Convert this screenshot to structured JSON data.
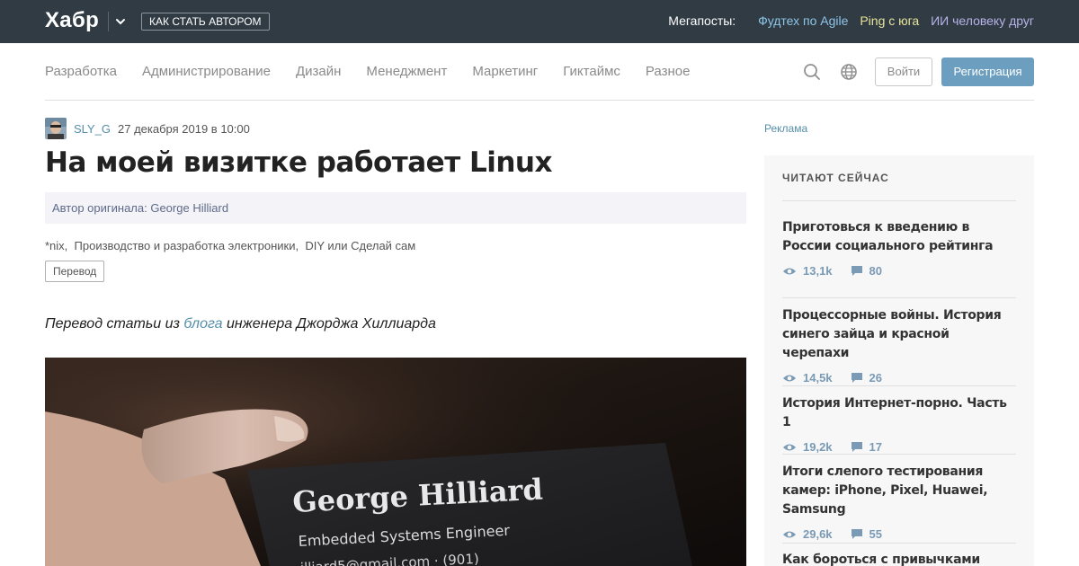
{
  "topbar": {
    "logo": "Хабр",
    "become_author": "КАК СТАТЬ АВТОРОМ",
    "megaposts_label": "Мегапосты:",
    "megaposts": [
      {
        "label": "Фудтех по Agile",
        "color": "#8ec5e8"
      },
      {
        "label": "Ping с юга",
        "color": "#e8e49a"
      },
      {
        "label": "ИИ человеку друг",
        "color": "#b8b3e8"
      }
    ]
  },
  "nav": {
    "items": [
      "Разработка",
      "Администрирование",
      "Дизайн",
      "Менеджмент",
      "Маркетинг",
      "Гиктаймс",
      "Разное"
    ],
    "login": "Войти",
    "register": "Регистрация"
  },
  "article": {
    "author": "SLY_G",
    "date": "27 декабря 2019 в 10:00",
    "title": "На моей визитке работает Linux",
    "original_author": "Автор оригинала: George Hilliard",
    "hubs": [
      "*nix,",
      "Производство и разработка электроники,",
      "DIY или Сделай сам"
    ],
    "badge": "Перевод",
    "lead_before": "Перевод статьи из ",
    "lead_link": "блога",
    "lead_after": " инженера Джорджа Хиллиарда",
    "card_name": "George Hilliard",
    "card_role": "Embedded Systems Engineer",
    "card_contact": "...illiard5@gmail.com · (901)"
  },
  "sidebar": {
    "ad_label": "Реклама",
    "heading": "ЧИТАЮТ СЕЙЧАС",
    "items": [
      {
        "title": "Приготовься к введению в России социального рейтинга",
        "views": "13,1k",
        "comments": "80"
      },
      {
        "title": "Процессорные войны. История синего зайца и красной черепахи",
        "views": "14,5k",
        "comments": "26"
      },
      {
        "title": "История Интернет-порно. Часть 1",
        "views": "19,2k",
        "comments": "17"
      },
      {
        "title": "Итоги слепого тестирования камер: iPhone, Pixel, Huawei, Samsung",
        "views": "29,6k",
        "comments": "55"
      },
      {
        "title": "Как бороться с привычками",
        "views": "",
        "comments": ""
      }
    ]
  }
}
